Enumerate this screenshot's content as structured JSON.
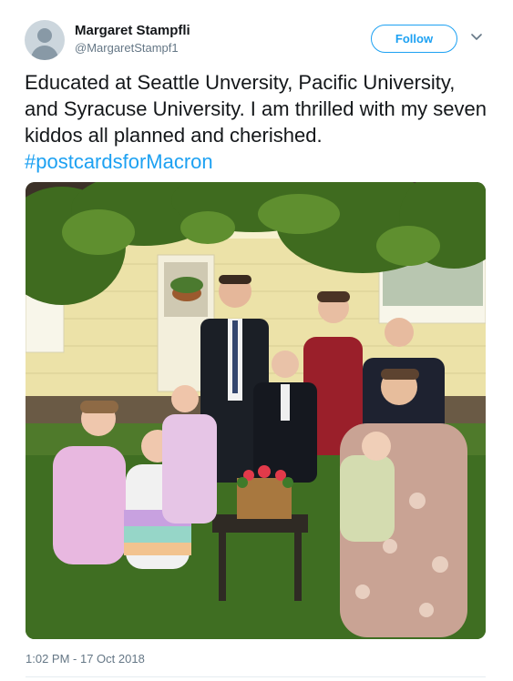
{
  "user": {
    "display_name": "Margaret Stampfli",
    "handle": "@MargaretStampf1"
  },
  "actions": {
    "follow_label": "Follow",
    "more_icon": "chevron-down-icon"
  },
  "tweet": {
    "text": "Educated at Seattle Unversity, Pacific University, and Syracuse University. I am thrilled with my seven kiddos all planned and cherished.",
    "hashtag": "#postcardsforMacron",
    "timestamp": "1:02 PM - 17 Oct 2018"
  },
  "colors": {
    "accent": "#1da1f2",
    "secondary_text": "#657786",
    "primary_text": "#14171a"
  }
}
